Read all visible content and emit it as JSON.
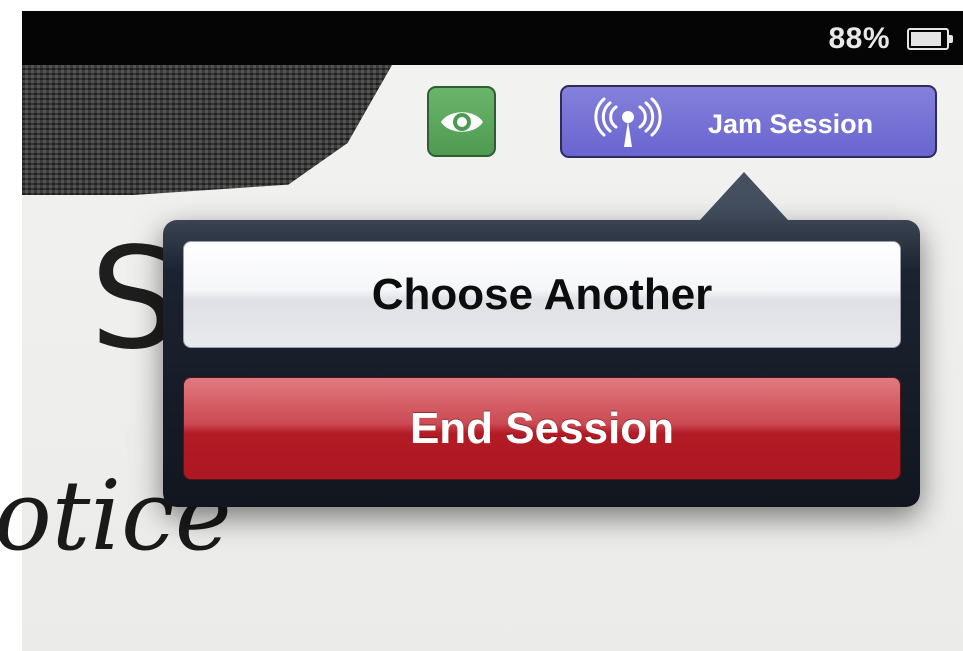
{
  "status_bar": {
    "battery_percent": "88%",
    "battery_level": 0.88,
    "battery_icon": "battery-icon"
  },
  "canvas": {
    "handwriting_top": "S",
    "handwriting_bottom": "otice"
  },
  "toolbar": {
    "view_icon": "eye-icon",
    "view_color": "#5aa85d",
    "jam_session_label": "Jam Session",
    "jam_session_icon": "broadcast-antenna-icon",
    "jam_session_color": "#7470d6"
  },
  "popover": {
    "choose_another_label": "Choose Another",
    "end_session_label": "End Session",
    "end_session_color": "#b3202a"
  }
}
